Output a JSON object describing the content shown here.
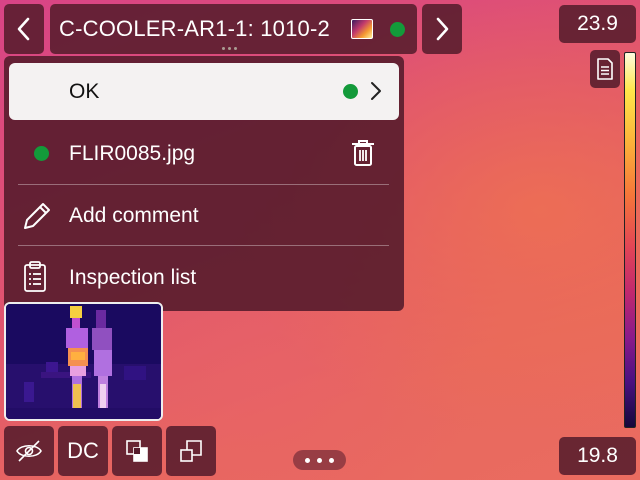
{
  "header": {
    "title": "C-COOLER-AR1-1: 1010-2",
    "icons": {
      "prev": "chevron-left-icon",
      "next": "chevron-right-icon",
      "thumbnail": "thermal-image-icon",
      "status": "status-dot-green"
    }
  },
  "menu": {
    "ok": {
      "label": "OK",
      "status_color": "#139a3a",
      "icon": "chevron-right-icon"
    },
    "file": {
      "label": "FLIR0085.jpg",
      "status_color": "#139a3a",
      "icon": "trash-icon"
    },
    "comment": {
      "label": "Add comment",
      "icon": "pencil-icon"
    },
    "inspection": {
      "label": "Inspection list",
      "icon": "clipboard-icon"
    }
  },
  "scale": {
    "max": "23.9",
    "min": "19.8",
    "palette": "iron",
    "doc_icon": "document-icon"
  },
  "bottom_bar": {
    "hide_icon": "eye-off-icon",
    "dc_label": "DC",
    "overlay_icon": "image-overlay-icon",
    "resize_icon": "resize-icon",
    "more_icon": "more-horizontal-icon"
  },
  "colors": {
    "panel": "#561c2c",
    "status_green": "#139a3a",
    "background": "#e0546f"
  }
}
